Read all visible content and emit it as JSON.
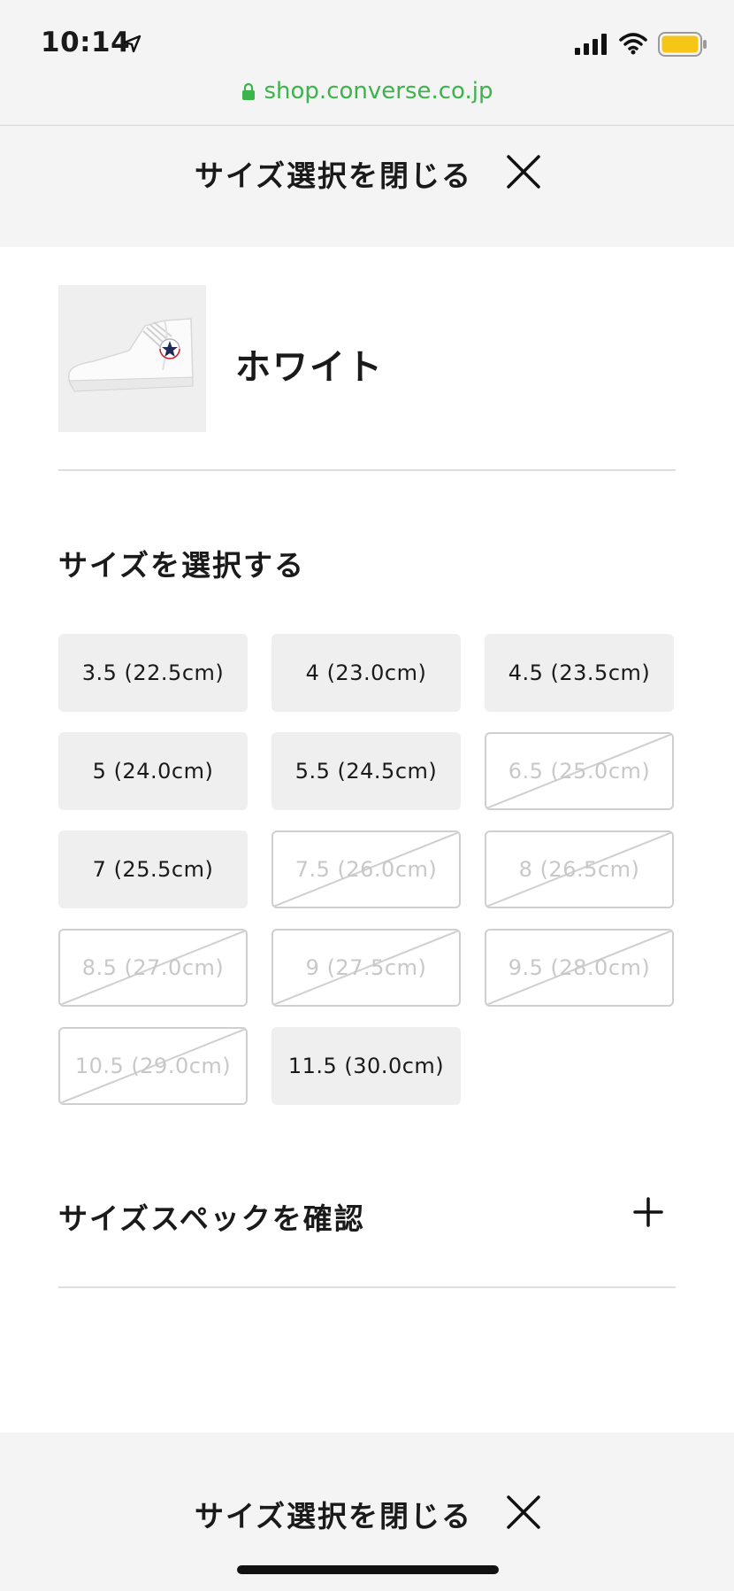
{
  "status_bar": {
    "time": "10:14",
    "icons": [
      "location-arrow-icon",
      "cellular-signal-icon",
      "wifi-icon",
      "battery-icon"
    ],
    "battery_color": "#f5c518"
  },
  "browser": {
    "url": "shop.converse.co.jp",
    "url_color": "#3cb44a"
  },
  "header": {
    "close_label": "サイズ選択を閉じる"
  },
  "product": {
    "image_icon": "white-high-top-sneaker",
    "color_name": "ホワイト"
  },
  "size_section": {
    "title": "サイズを選択する",
    "sizes": [
      {
        "label": "3.5 (22.5cm)",
        "available": true
      },
      {
        "label": "4 (23.0cm)",
        "available": true
      },
      {
        "label": "4.5 (23.5cm)",
        "available": true
      },
      {
        "label": "5 (24.0cm)",
        "available": true
      },
      {
        "label": "5.5 (24.5cm)",
        "available": true
      },
      {
        "label": "6.5 (25.0cm)",
        "available": false
      },
      {
        "label": "7 (25.5cm)",
        "available": true
      },
      {
        "label": "7.5 (26.0cm)",
        "available": false
      },
      {
        "label": "8 (26.5cm)",
        "available": false
      },
      {
        "label": "8.5 (27.0cm)",
        "available": false
      },
      {
        "label": "9 (27.5cm)",
        "available": false
      },
      {
        "label": "9.5 (28.0cm)",
        "available": false
      },
      {
        "label": "10.5 (29.0cm)",
        "available": false
      },
      {
        "label": "11.5 (30.0cm)",
        "available": true
      }
    ]
  },
  "spec": {
    "label": "サイズスペックを確認",
    "icon": "plus-icon"
  },
  "footer": {
    "close_label": "サイズ選択を閉じる"
  }
}
